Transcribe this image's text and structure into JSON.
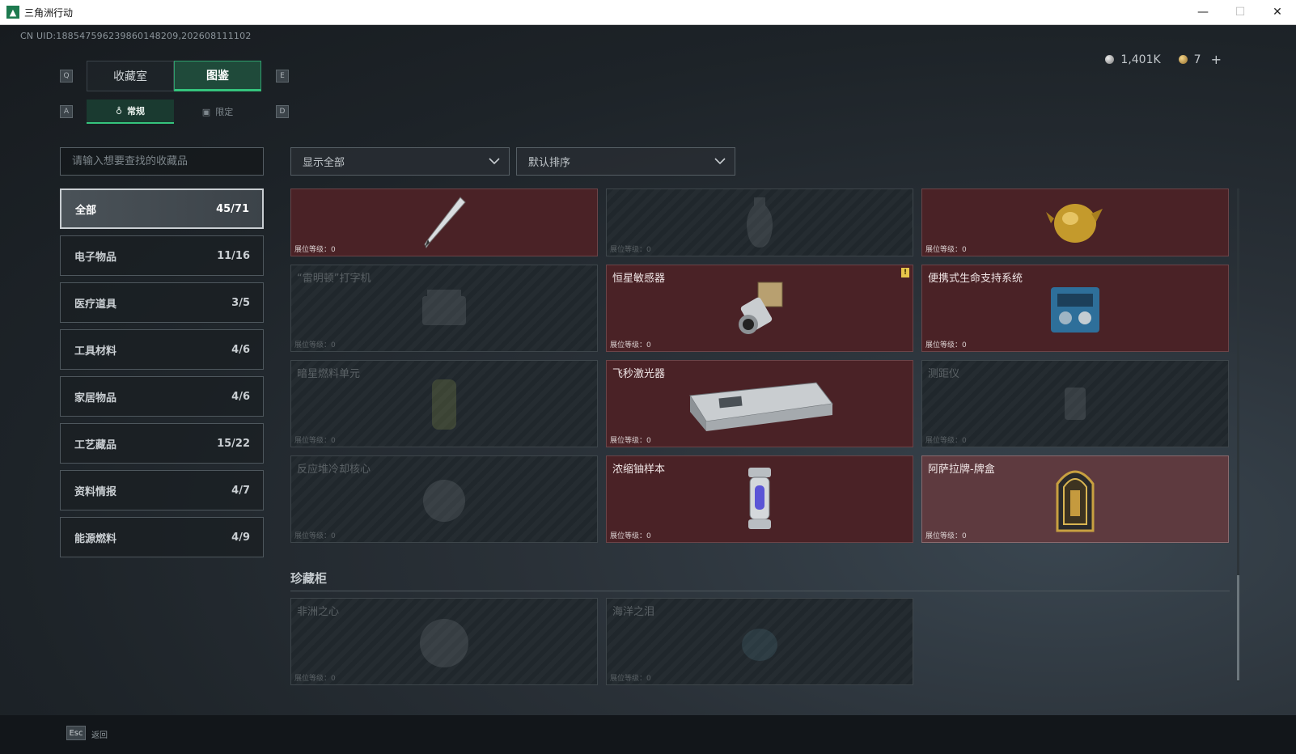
{
  "window": {
    "title": "三角洲行动",
    "minimize": "—",
    "maximize": "☐",
    "close": "✕"
  },
  "uid": "CN UID:1885475962398601482​09,202608111102",
  "currency": {
    "silver": "1,401K",
    "gold": "7",
    "add": "+"
  },
  "keys": {
    "q": "Q",
    "e": "E",
    "a": "A",
    "d": "D"
  },
  "tabs": {
    "collection": "收藏室",
    "codex": "图鉴"
  },
  "subtabs": {
    "regular": "常规",
    "limited": "限定"
  },
  "search": {
    "placeholder": "请输入想要查找的收藏品"
  },
  "filters": {
    "show": "显示全部",
    "sort": "默认排序"
  },
  "categories": [
    {
      "label": "全部",
      "count": "45/71"
    },
    {
      "label": "电子物品",
      "count": "11/16"
    },
    {
      "label": "医疗道具",
      "count": "3/5"
    },
    {
      "label": "工具材料",
      "count": "4/6"
    },
    {
      "label": "家居物品",
      "count": "4/6"
    },
    {
      "label": "工艺藏品",
      "count": "15/22"
    },
    {
      "label": "资料情报",
      "count": "4/7"
    },
    {
      "label": "能源燃料",
      "count": "4/9"
    }
  ],
  "level_label": "展位等级：0",
  "items": [
    {
      "name": "",
      "owned": true,
      "art": "pen-icon"
    },
    {
      "name": "",
      "owned": false,
      "art": "vase-icon"
    },
    {
      "name": "",
      "owned": true,
      "art": "golden-beast-icon"
    },
    {
      "name": "“雷明顿”打字机",
      "owned": false,
      "art": "typewriter-icon"
    },
    {
      "name": "恒星敏感器",
      "owned": true,
      "art": "star-sensor-icon",
      "alert": "!"
    },
    {
      "name": "便携式生命支持系统",
      "owned": true,
      "art": "life-support-icon"
    },
    {
      "name": "暗星燃料单元",
      "owned": false,
      "art": "fuel-cell-icon"
    },
    {
      "name": "飞秒激光器",
      "owned": true,
      "art": "laser-icon"
    },
    {
      "name": "测距仪",
      "owned": false,
      "art": "rangefinder-icon"
    },
    {
      "name": "反应堆冷却核心",
      "owned": false,
      "art": "reactor-core-icon"
    },
    {
      "name": "浓缩铀样本",
      "owned": true,
      "art": "uranium-icon"
    },
    {
      "name": "阿萨拉牌-牌盒",
      "owned": true,
      "highlight": true,
      "art": "card-box-icon"
    }
  ],
  "section": {
    "title": "珍藏柜"
  },
  "treasures": [
    {
      "name": "非洲之心",
      "owned": false,
      "art": "heart-gem-icon"
    },
    {
      "name": "海洋之泪",
      "owned": false,
      "art": "ocean-tear-icon"
    }
  ],
  "footer": {
    "esc": "Esc",
    "back": "返回"
  }
}
